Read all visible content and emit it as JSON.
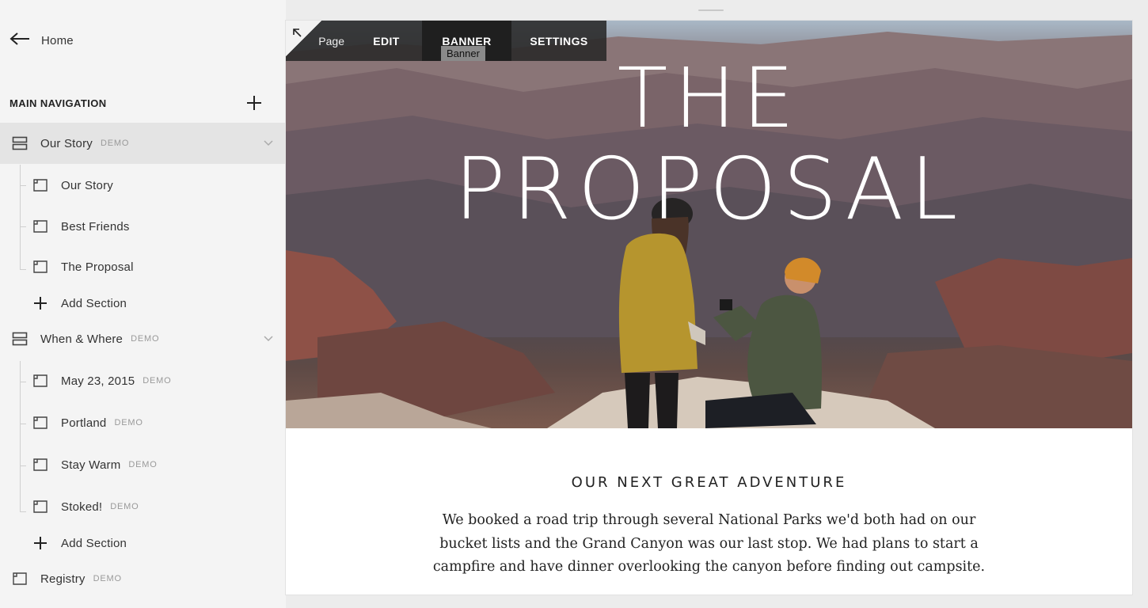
{
  "sidebar": {
    "home_label": "Home",
    "nav_header": "MAIN NAVIGATION",
    "items": [
      {
        "label": "Our Story",
        "badge": "DEMO"
      },
      {
        "label": "Our Story"
      },
      {
        "label": "Best Friends"
      },
      {
        "label": "The Proposal"
      },
      {
        "label": "Add Section"
      },
      {
        "label": "When & Where",
        "badge": "DEMO"
      },
      {
        "label": "May 23, 2015",
        "badge": "DEMO"
      },
      {
        "label": "Portland",
        "badge": "DEMO"
      },
      {
        "label": "Stay Warm",
        "badge": "DEMO"
      },
      {
        "label": "Stoked!",
        "badge": "DEMO"
      },
      {
        "label": "Add Section"
      },
      {
        "label": "Registry",
        "badge": "DEMO"
      }
    ]
  },
  "toolbar": {
    "page_label": "Page",
    "edit_label": "EDIT",
    "banner_label": "BANNER",
    "settings_label": "SETTINGS",
    "tooltip": "Banner"
  },
  "banner": {
    "title_line1": "THE",
    "title_line2": "PROPOSAL"
  },
  "content": {
    "heading": "OUR NEXT GREAT ADVENTURE",
    "body": "We booked a road trip through several National Parks we'd both had on our bucket lists and the Grand Canyon was our last stop. We had plans to start a campfire and have dinner overlooking the canyon before finding out campsite."
  },
  "colors": {
    "sidebar_bg": "#f4f4f4",
    "active_row_bg": "#e4e4e4",
    "toolbar_bg": "#282828",
    "demo_badge": "#999999"
  }
}
